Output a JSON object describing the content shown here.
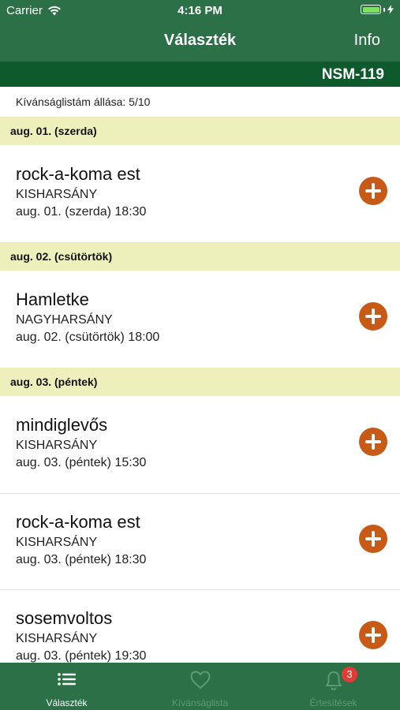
{
  "status_bar": {
    "carrier": "Carrier",
    "time": "4:16 PM"
  },
  "nav": {
    "title": "Választék",
    "info": "Info"
  },
  "code": "NSM-119",
  "wishlist_status": "Kívánságlistám állása: 5/10",
  "sections": [
    {
      "header": "aug. 01. (szerda)",
      "events": [
        {
          "title": "rock-a-koma est",
          "location": "KISHARSÁNY",
          "datetime": "aug. 01. (szerda) 18:30"
        }
      ]
    },
    {
      "header": "aug. 02. (csütörtök)",
      "events": [
        {
          "title": "Hamletke",
          "location": "NAGYHARSÁNY",
          "datetime": "aug. 02. (csütörtök) 18:00"
        }
      ]
    },
    {
      "header": "aug. 03. (péntek)",
      "events": [
        {
          "title": "mindiglevős",
          "location": "KISHARSÁNY",
          "datetime": "aug. 03. (péntek) 15:30"
        },
        {
          "title": "rock-a-koma est",
          "location": "KISHARSÁNY",
          "datetime": "aug. 03. (péntek) 18:30"
        },
        {
          "title": "sosemvoltos",
          "location": "KISHARSÁNY",
          "datetime": "aug. 03. (péntek) 19:30"
        }
      ]
    }
  ],
  "tabs": [
    {
      "label": "Választék",
      "icon": "list-icon",
      "active": true
    },
    {
      "label": "Kívánságlista",
      "icon": "heart-icon",
      "active": false
    },
    {
      "label": "Értesítések",
      "icon": "bell-icon",
      "active": false,
      "badge": "3"
    }
  ],
  "colors": {
    "primary": "#2b7046",
    "code_bar": "#0e5a2c",
    "section_header": "#eef0bb",
    "add_button": "#c65a16",
    "badge": "#e53935"
  }
}
